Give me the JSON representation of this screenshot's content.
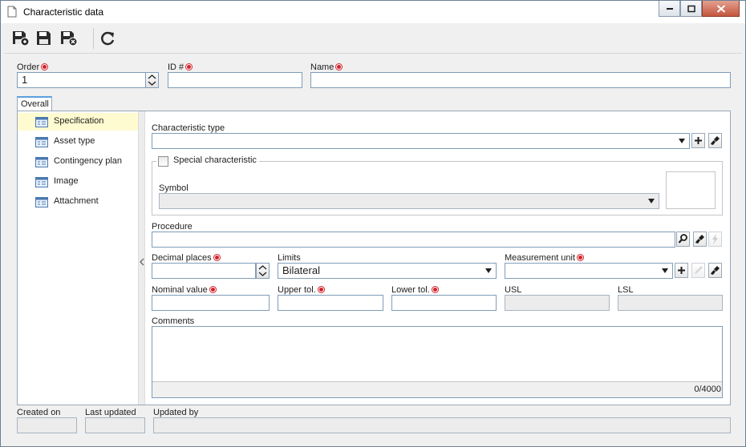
{
  "window": {
    "title": "Characteristic data"
  },
  "toolbar": {
    "buttons": [
      "save-and-new-icon",
      "save-icon",
      "save-and-close-icon",
      "refresh-icon"
    ]
  },
  "header": {
    "order_label": "Order",
    "order_value": "1",
    "id_label": "ID #",
    "id_value": "",
    "name_label": "Name",
    "name_value": ""
  },
  "tabs": {
    "overall": "Overall"
  },
  "sidebar": {
    "items": [
      {
        "label": "Specification",
        "selected": true
      },
      {
        "label": "Asset type"
      },
      {
        "label": "Contingency plan"
      },
      {
        "label": "Image"
      },
      {
        "label": "Attachment"
      }
    ]
  },
  "form": {
    "characteristic_type_label": "Characteristic type",
    "characteristic_type_value": "",
    "special_label": "Special characteristic",
    "special_checked": false,
    "symbol_label": "Symbol",
    "symbol_value": "",
    "procedure_label": "Procedure",
    "procedure_value": "",
    "decimal_places_label": "Decimal places",
    "decimal_places_value": "",
    "limits_label": "Limits",
    "limits_value": "Bilateral",
    "measurement_unit_label": "Measurement unit",
    "measurement_unit_value": "",
    "nominal_value_label": "Nominal value",
    "upper_tol_label": "Upper tol.",
    "lower_tol_label": "Lower tol.",
    "usl_label": "USL",
    "lsl_label": "LSL",
    "comments_label": "Comments",
    "comments_value": "",
    "comments_count": "0/4000"
  },
  "footer": {
    "created_on_label": "Created on",
    "last_updated_label": "Last updated",
    "updated_by_label": "Updated by"
  },
  "colors": {
    "accent": "#5aa0e0",
    "required": "#d2232a",
    "selected_row": "#fffbd0",
    "input_border": "#7f9db9"
  }
}
